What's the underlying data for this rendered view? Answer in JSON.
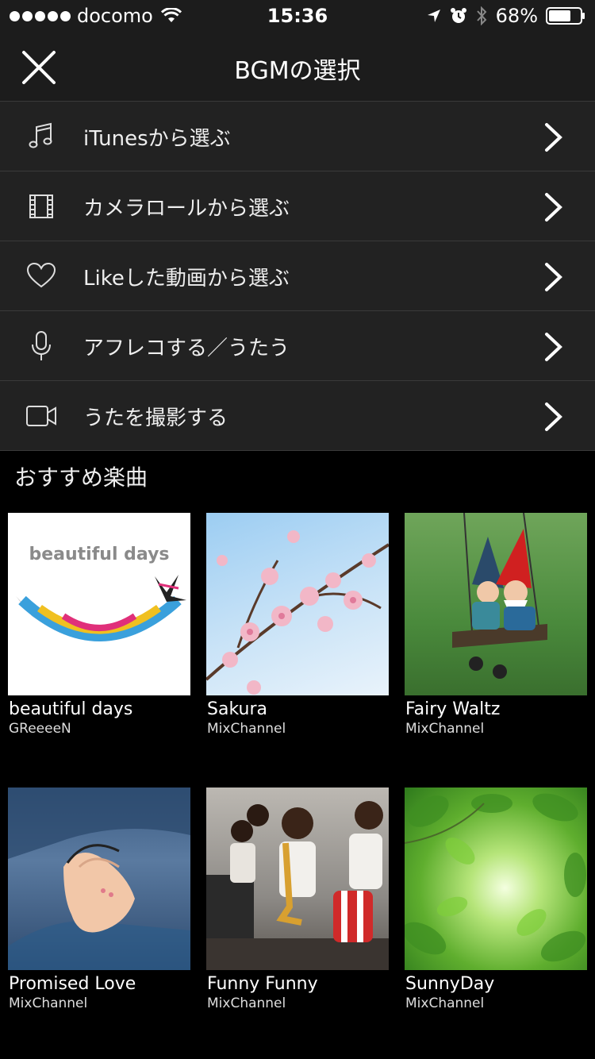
{
  "status_bar": {
    "carrier": "docomo",
    "time": "15:36",
    "battery": "68%"
  },
  "header": {
    "title": "BGMの選択"
  },
  "menu": {
    "items": [
      {
        "label": "iTunesから選ぶ",
        "icon": "music-note-icon"
      },
      {
        "label": "カメラロールから選ぶ",
        "icon": "film-icon"
      },
      {
        "label": "Likeした動画から選ぶ",
        "icon": "heart-icon"
      },
      {
        "label": "アフレコする／うたう",
        "icon": "microphone-icon"
      },
      {
        "label": "うたを撮影する",
        "icon": "video-camera-icon"
      }
    ]
  },
  "recommended": {
    "title": "おすすめ楽曲",
    "tracks": [
      {
        "title": "beautiful days",
        "artist": "GReeeeN",
        "art_text": "beautiful days",
        "art_logo": "GReeeeN"
      },
      {
        "title": "Sakura",
        "artist": "MixChannel"
      },
      {
        "title": "Fairy Waltz",
        "artist": "MixChannel"
      },
      {
        "title": "Promised Love",
        "artist": "MixChannel"
      },
      {
        "title": "Funny Funny",
        "artist": "MixChannel"
      },
      {
        "title": "SunnyDay",
        "artist": "MixChannel"
      }
    ]
  },
  "colors": {
    "background": "#000000",
    "bar": "#1c1c1c",
    "menu_item": "#222222",
    "divider": "#3a3a3a"
  }
}
